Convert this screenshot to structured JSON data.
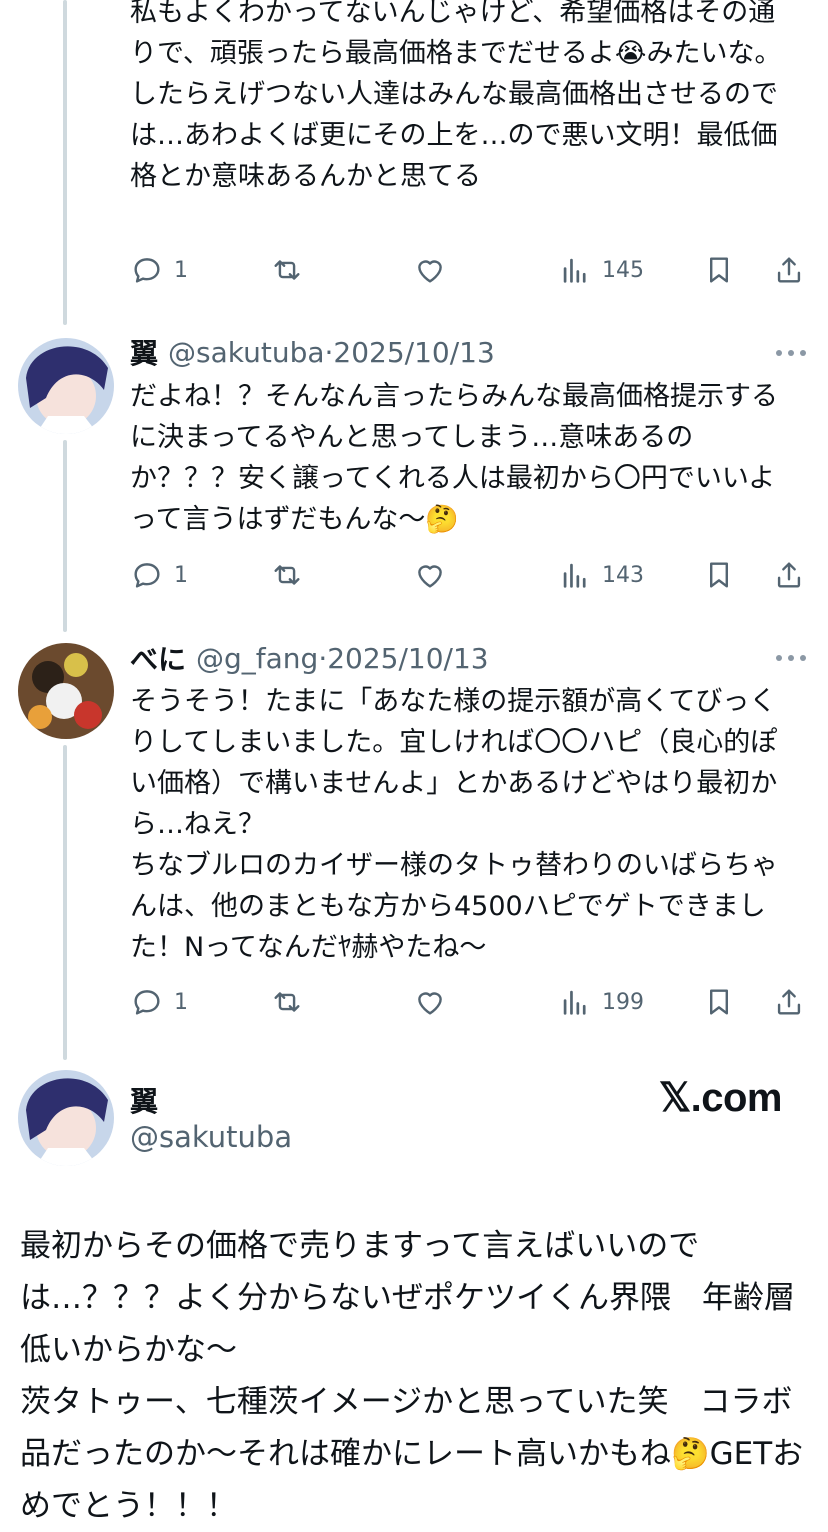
{
  "tweets": [
    {
      "text": "私もよくわかってないんじゃけど、希望価格はその通りで、頑張ったら最高価格までだせるよ😭みたいな。\nしたらえげつない人達はみんな最高価格出させるのでは…あわよくば更にその上を…ので悪い文明！最低価格とか意味あるんかと思てる",
      "replies": "1",
      "views": "145"
    },
    {
      "name": "翼",
      "handle": "@sakutuba·2025/10/13",
      "text": "だよね！？そんなん言ったらみんな最高価格提示するに決まってるやんと思ってしまう…意味あるのか？？？安く譲ってくれる人は最初から〇円でいいよって言うはずだもんな〜🤔",
      "replies": "1",
      "views": "143"
    },
    {
      "name": "べに",
      "handle": "@g_fang·2025/10/13",
      "text": "そうそう！たまに「あなた様の提示額が高くてびっくりしてしまいました。宜しければ〇〇ハピ（良心的ぽい価格）で構いませんよ」とかあるけどやはり最初から…ねえ？\nちなブルロのカイザー様のタトゥ替わりのいばらちゃんは、他のまともな方から4500ハピでゲトできました！Nってなんだﾔ赫やたね〜",
      "replies": "1",
      "views": "199"
    }
  ],
  "main": {
    "name": "翼",
    "handle": "@sakutuba",
    "brand": "𝕏.com",
    "text": "最初からその価格で売りますって言えばいいのでは…？？？よく分からないぜポケツイくん界隈　年齢層低いからかな〜\n茨タトゥー、七種茨イメージかと思っていた笑　コラボ品だったのか〜それは確かにレート高いかもね🤔GETおめでとう！！！"
  },
  "colors": {
    "text": "#0f1419",
    "secondary": "#536471",
    "thread_line": "#cfd9de"
  }
}
